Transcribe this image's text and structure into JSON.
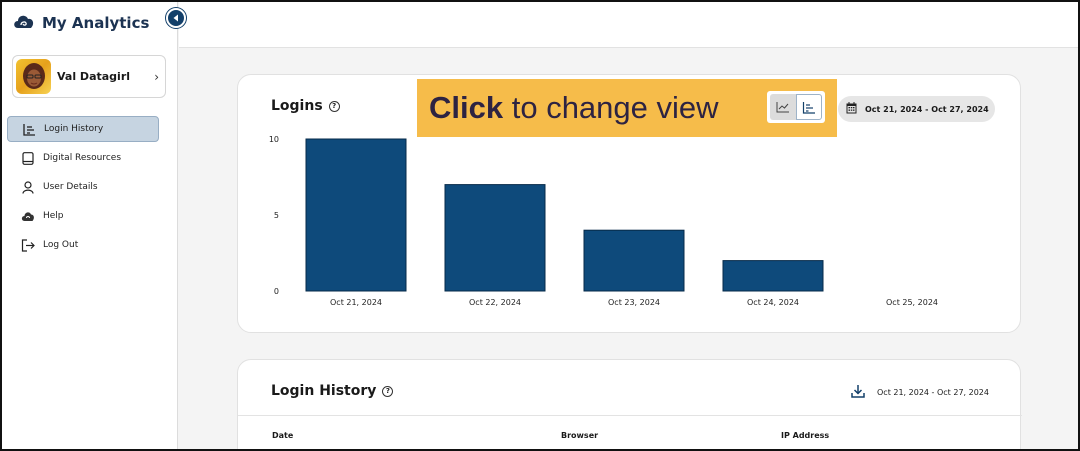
{
  "app": {
    "title": "My Analytics"
  },
  "profile": {
    "name": "Val Datagirl",
    "chevron": "›"
  },
  "nav": {
    "items": [
      {
        "label": "Login History",
        "icon": "list-chart-icon",
        "active": true
      },
      {
        "label": "Digital Resources",
        "icon": "tablet-icon",
        "active": false
      },
      {
        "label": "User Details",
        "icon": "user-icon",
        "active": false
      },
      {
        "label": "Help",
        "icon": "help-cloud-icon",
        "active": false
      },
      {
        "label": "Log Out",
        "icon": "logout-icon",
        "active": false
      }
    ]
  },
  "logins_card": {
    "title": "Logins",
    "help": "?",
    "date_range": "Oct 21, 2024 - Oct 27, 2024"
  },
  "callout": {
    "bold": "Click",
    "rest": " to change view"
  },
  "history_card": {
    "title": "Login History",
    "help": "?",
    "date_range": "Oct 21, 2024 - Oct 27, 2024",
    "columns": [
      "Date",
      "Browser",
      "IP Address"
    ]
  },
  "colors": {
    "bar": "#0e4a7b",
    "callout": "#f6bc4a",
    "brand": "#1c3352",
    "active_nav": "#c6d4e1"
  },
  "chart_data": {
    "type": "bar",
    "categories": [
      "Oct 21, 2024",
      "Oct 22, 2024",
      "Oct 23, 2024",
      "Oct 24, 2024",
      "Oct 25, 2024"
    ],
    "values": [
      10,
      7,
      4,
      2,
      0
    ],
    "yticks": [
      0,
      5,
      10
    ],
    "ylim": [
      0,
      10
    ],
    "title": "Logins",
    "grid": false,
    "legend": "none"
  }
}
